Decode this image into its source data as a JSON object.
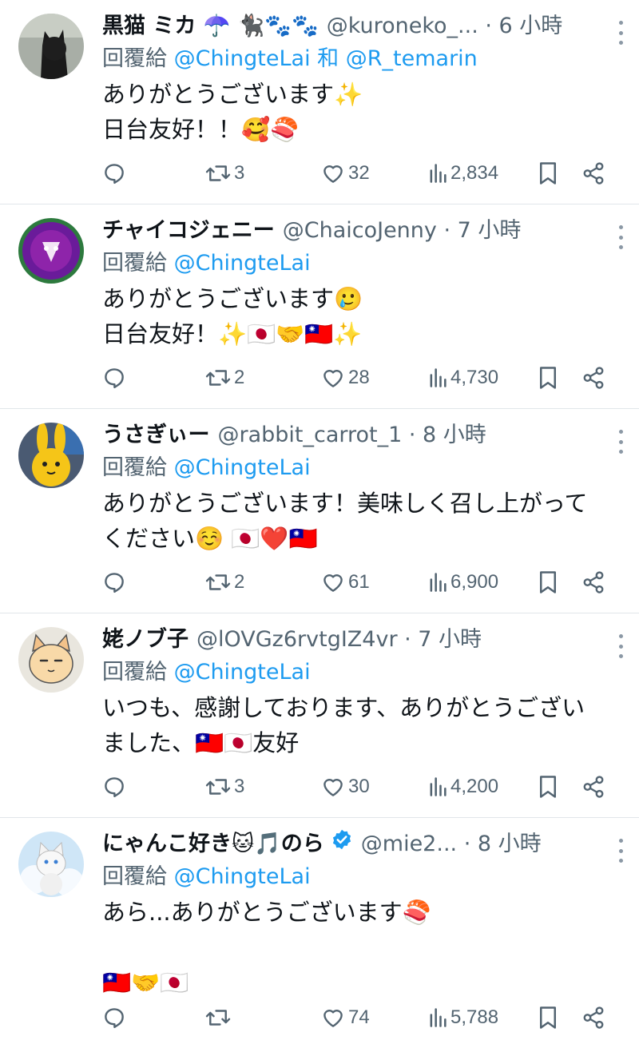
{
  "tweets": [
    {
      "display_name": "黒猫 ミカ ☂️ 🐈‍⬛🐾🐾",
      "handle_time": "@kuroneko_... · 6 小時",
      "reply_prefix": "回覆給",
      "reply_mentions": "@ChingteLai 和 @R_temarin",
      "body": "ありがとうございます✨\n日台友好！！🥰🍣",
      "replies": "",
      "retweets": "3",
      "likes": "32",
      "views": "2,834",
      "avatar": "black-cat-avatar",
      "verified": false
    },
    {
      "display_name": "チャイコジェニー",
      "handle_time": "@ChaicoJenny · 7 小時",
      "reply_prefix": "回覆給",
      "reply_mentions": "@ChingteLai",
      "body": "ありがとうございます🥲\n日台友好！✨🇯🇵🤝🇹🇼✨",
      "replies": "",
      "retweets": "2",
      "likes": "28",
      "views": "4,730",
      "avatar": "purple-fluffy-avatar",
      "verified": false
    },
    {
      "display_name": "うさぎぃー",
      "handle_time": "@rabbit_carrot_1 · 8 小時",
      "reply_prefix": "回覆給",
      "reply_mentions": "@ChingteLai",
      "body": "ありがとうございます！美味しく召し上がって\nください☺️ 🇯🇵❤️🇹🇼",
      "replies": "",
      "retweets": "2",
      "likes": "61",
      "views": "6,900",
      "avatar": "yellow-rabbit-avatar",
      "verified": false
    },
    {
      "display_name": "姥ノブ子",
      "handle_time": "@lOVGz6rvtgIZ4vr · 7 小時",
      "reply_prefix": "回覆給",
      "reply_mentions": "@ChingteLai",
      "body": "いつも、感謝しております、ありがとうござい\nました、🇹🇼🇯🇵友好",
      "replies": "",
      "retweets": "3",
      "likes": "30",
      "views": "4,200",
      "avatar": "cartoon-cat-avatar",
      "verified": false
    },
    {
      "display_name": "にゃんこ好き🐱🎵のら",
      "handle_time": "@mie2... · 8 小時",
      "reply_prefix": "回覆給",
      "reply_mentions": "@ChingteLai",
      "body": "あら...ありがとうございます🍣\n\n🇹🇼🤝🇯🇵",
      "replies": "",
      "retweets": "",
      "likes": "74",
      "views": "5,788",
      "avatar": "white-cat-avatar",
      "verified": true
    }
  ],
  "icons": {
    "reply": "reply-icon",
    "retweet": "retweet-icon",
    "like": "heart-icon",
    "views": "views-chart-icon",
    "bookmark": "bookmark-icon",
    "share": "share-icon",
    "more": "more-options-icon",
    "verified": "verified-badge-icon"
  },
  "colors": {
    "text": "#0f1419",
    "secondary": "#536471",
    "link": "#1d9bf0",
    "divider": "#e1e6ea",
    "verified": "#1d9bf0"
  }
}
